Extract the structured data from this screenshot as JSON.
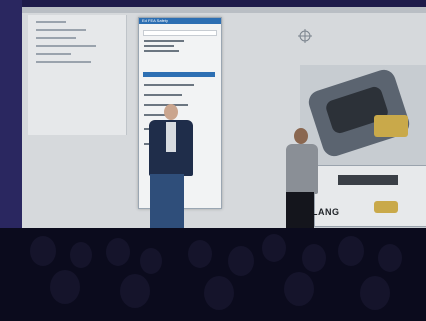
{
  "scene": {
    "screen_brand_text": "LANG",
    "dialog_title": "Ed FEA Safety"
  },
  "colors": {
    "screen_bg": "#d6d9dc",
    "frame": "#2a2760",
    "dialog_header": "#2d6fb3",
    "model_metal": "#5b6470",
    "model_accent": "#c9a94a",
    "audience": "#0b0b1d"
  }
}
